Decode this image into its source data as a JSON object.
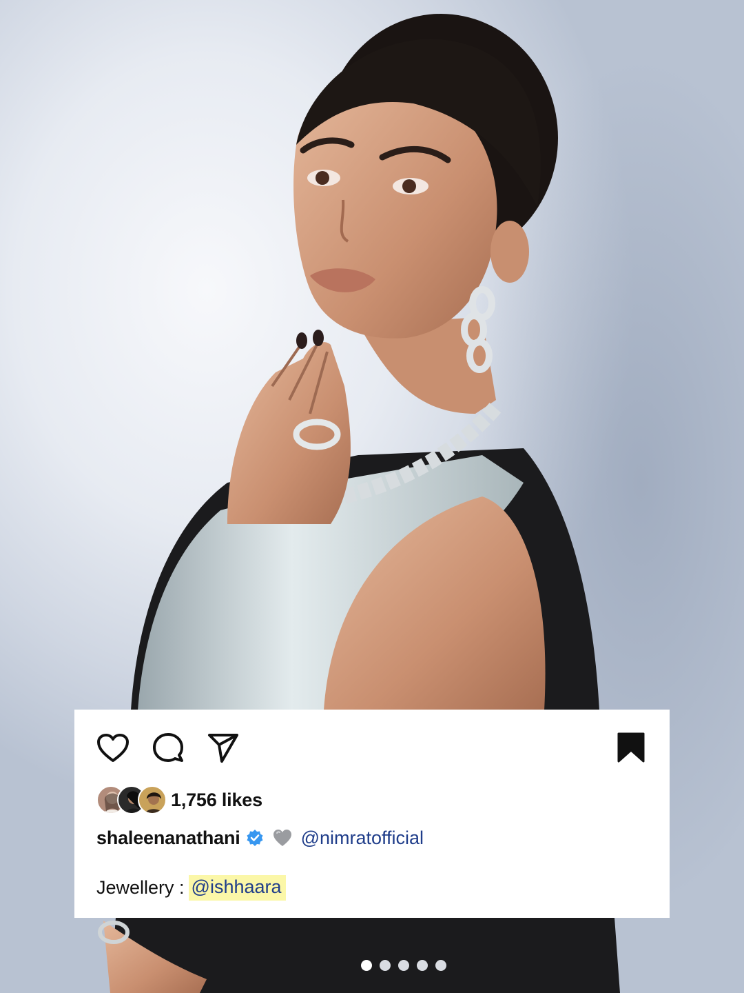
{
  "post": {
    "likes_text": "1,756 likes",
    "username": "shaleenanathani",
    "mention": "@nimratofficial",
    "caption_label": "Jewellery : ",
    "caption_mention": "@ishhaara"
  },
  "icons": {
    "like": "heart-outline-icon",
    "comment": "comment-bubble-icon",
    "share": "paper-plane-icon",
    "save": "bookmark-filled-icon",
    "verified": "verified-badge-icon",
    "emoji": "grey-heart-emoji"
  },
  "carousel": {
    "total": 5,
    "active_index": 0
  },
  "colors": {
    "card_bg": "#ffffff",
    "text": "#111111",
    "mention": "#1f3d8a",
    "highlight": "#fbf7a8",
    "verified": "#3797f0"
  }
}
